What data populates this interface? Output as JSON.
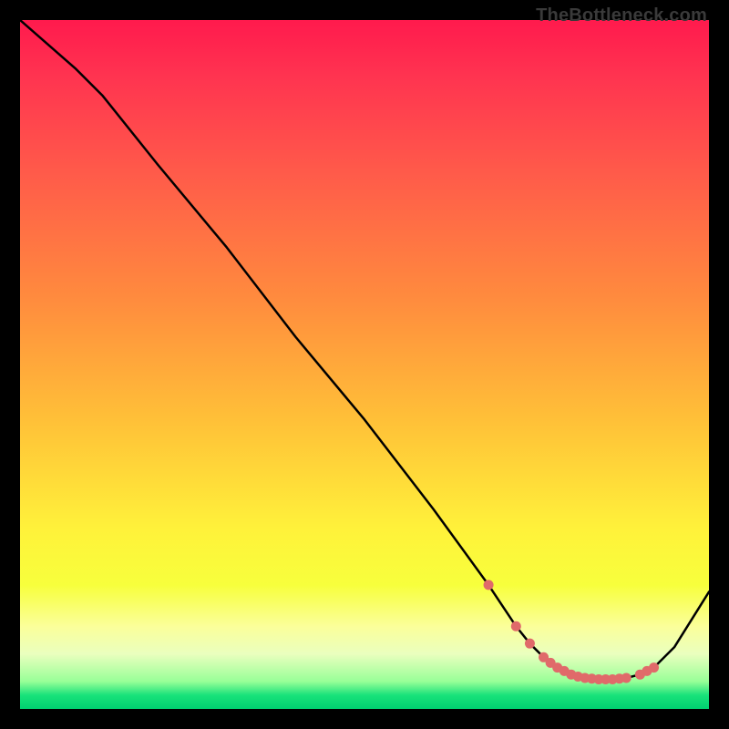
{
  "watermark": "TheBottleneck.com",
  "chart_data": {
    "type": "line",
    "title": "",
    "xlabel": "",
    "ylabel": "",
    "xlim": [
      0,
      100
    ],
    "ylim": [
      0,
      100
    ],
    "series": [
      {
        "name": "curve",
        "x": [
          0,
          8,
          12,
          20,
          30,
          40,
          50,
          60,
          68,
          72,
          74,
          76,
          78,
          80,
          82,
          84,
          86,
          88,
          90,
          92,
          95,
          100
        ],
        "values": [
          100,
          93,
          89,
          79,
          67,
          54,
          42,
          29,
          18,
          12,
          9.5,
          7.5,
          6,
          5,
          4.5,
          4.3,
          4.3,
          4.5,
          5,
          6,
          9,
          17
        ]
      }
    ],
    "markers": {
      "name": "highlight-dots",
      "color": "#e06a6a",
      "x": [
        68,
        72,
        74,
        76,
        77,
        78,
        79,
        80,
        81,
        82,
        83,
        84,
        85,
        86,
        87,
        88,
        90,
        91,
        92
      ],
      "values": [
        18,
        12,
        9.5,
        7.5,
        6.7,
        6,
        5.5,
        5,
        4.7,
        4.5,
        4.4,
        4.3,
        4.3,
        4.3,
        4.4,
        4.5,
        5,
        5.5,
        6
      ]
    }
  }
}
